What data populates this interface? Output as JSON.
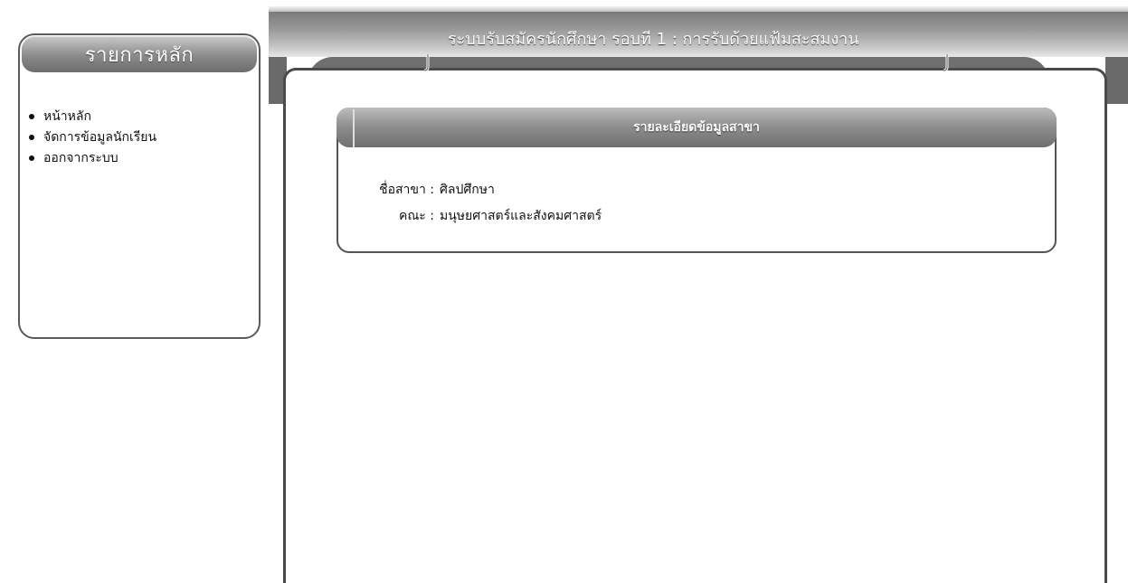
{
  "sidebar": {
    "title": "รายการหลัก",
    "items": [
      {
        "label": "หน้าหลัก"
      },
      {
        "label": "จัดการข้อมูลนักเรียน"
      },
      {
        "label": "ออกจากระบบ"
      }
    ]
  },
  "header": {
    "title": "ระบบรับสมัครนักศึกษา รอบที 1 : การรับด้วยแฟ้มสะสมงาน"
  },
  "detail": {
    "title": "รายละเอียดข้อมูลสาขา",
    "fields": [
      {
        "label": "ชื่อสาขา :",
        "value": "ศิลปศึกษา"
      },
      {
        "label": "คณะ :",
        "value": "มนุษยศาสตร์และสังคมศาสตร์"
      }
    ]
  },
  "colors": {
    "header_gray": "#7a7a7a",
    "border_gray": "#5a5a5a",
    "text": "#111111"
  }
}
